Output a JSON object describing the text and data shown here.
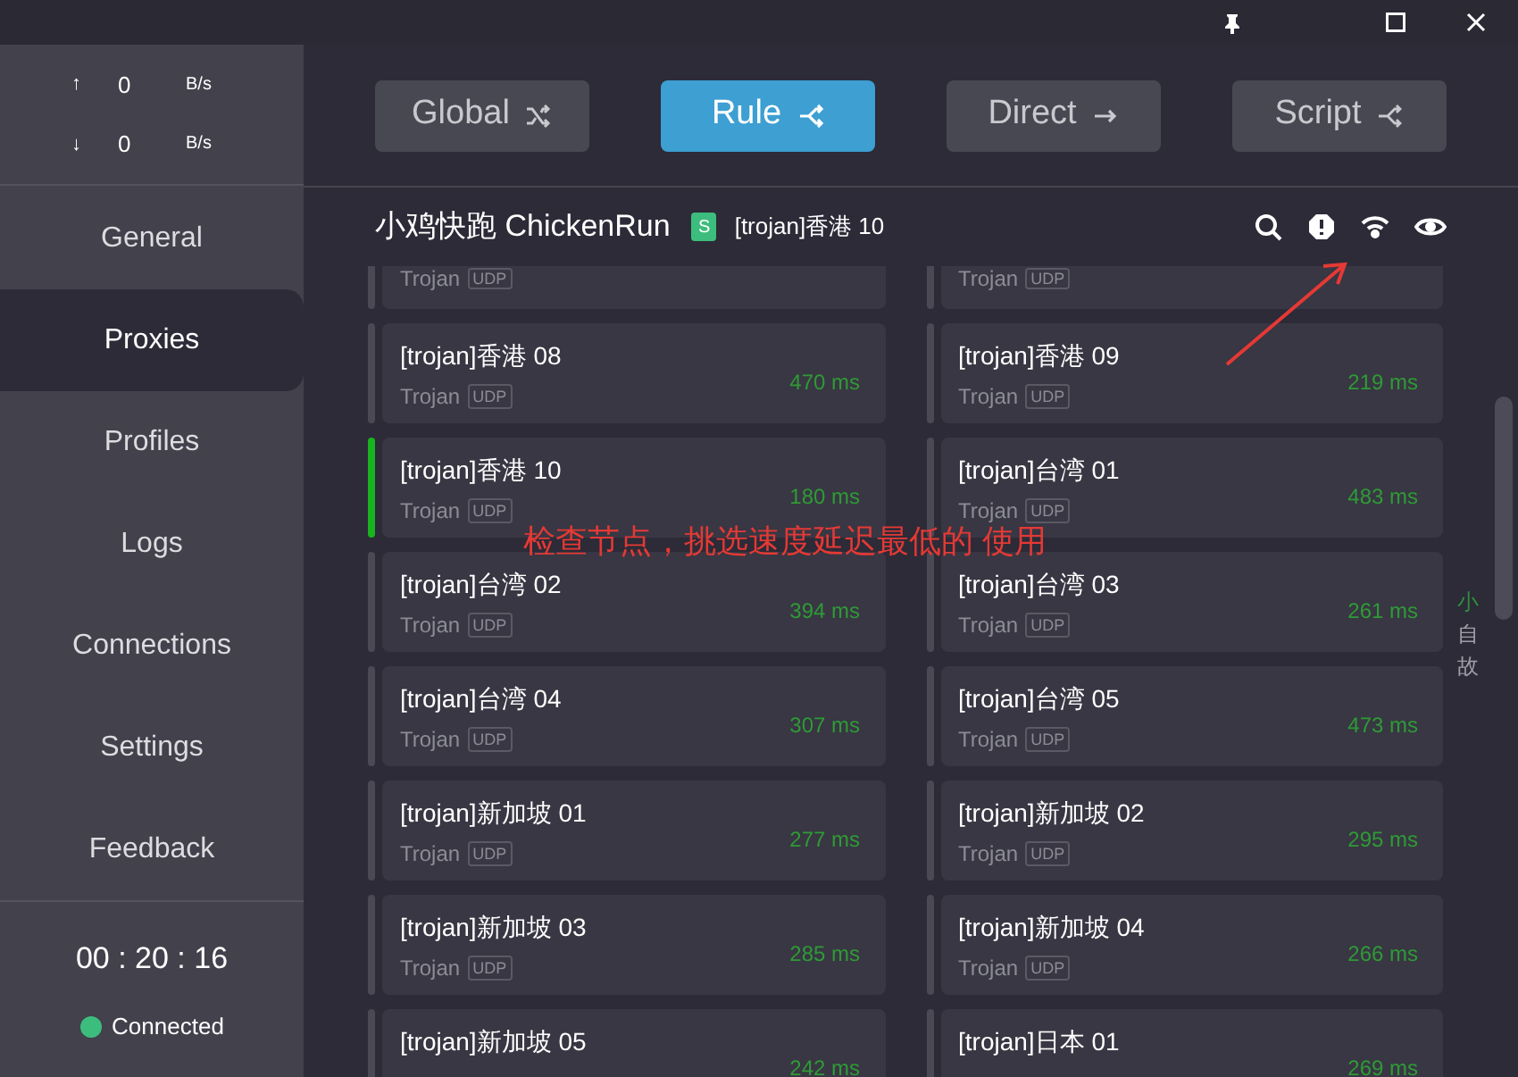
{
  "traffic": [
    {
      "arrow": "↑",
      "value": "0",
      "unit": "B/s"
    },
    {
      "arrow": "↓",
      "value": "0",
      "unit": "B/s"
    }
  ],
  "nav": [
    {
      "label": "General",
      "selected": false
    },
    {
      "label": "Proxies",
      "selected": true
    },
    {
      "label": "Profiles",
      "selected": false
    },
    {
      "label": "Logs",
      "selected": false
    },
    {
      "label": "Connections",
      "selected": false
    },
    {
      "label": "Settings",
      "selected": false
    },
    {
      "label": "Feedback",
      "selected": false
    }
  ],
  "timer": "00 : 20 : 16",
  "status": {
    "label": "Connected",
    "color": "#3dbd7d"
  },
  "modes": [
    {
      "label": "Global",
      "kind": "global",
      "selected": false
    },
    {
      "label": "Rule",
      "kind": "rule",
      "selected": true
    },
    {
      "label": "Direct",
      "kind": "direct",
      "selected": false
    },
    {
      "label": "Script",
      "kind": "script",
      "selected": false
    }
  ],
  "group": {
    "name": "小鸡快跑 ChickenRun",
    "badge": "S",
    "current": "[trojan]香港 10"
  },
  "partial_row": [
    {
      "type": "Trojan",
      "udp": "UDP"
    },
    {
      "type": "Trojan",
      "udp": "UDP"
    }
  ],
  "proxies": [
    {
      "name": "[trojan]香港 08",
      "type": "Trojan",
      "udp": "UDP",
      "delay": "470 ms",
      "selected": false
    },
    {
      "name": "[trojan]香港 09",
      "type": "Trojan",
      "udp": "UDP",
      "delay": "219 ms",
      "selected": false
    },
    {
      "name": "[trojan]香港 10",
      "type": "Trojan",
      "udp": "UDP",
      "delay": "180 ms",
      "selected": true
    },
    {
      "name": "[trojan]台湾 01",
      "type": "Trojan",
      "udp": "UDP",
      "delay": "483 ms",
      "selected": false
    },
    {
      "name": "[trojan]台湾 02",
      "type": "Trojan",
      "udp": "UDP",
      "delay": "394 ms",
      "selected": false
    },
    {
      "name": "[trojan]台湾 03",
      "type": "Trojan",
      "udp": "UDP",
      "delay": "261 ms",
      "selected": false
    },
    {
      "name": "[trojan]台湾 04",
      "type": "Trojan",
      "udp": "UDP",
      "delay": "307 ms",
      "selected": false
    },
    {
      "name": "[trojan]台湾 05",
      "type": "Trojan",
      "udp": "UDP",
      "delay": "473 ms",
      "selected": false
    },
    {
      "name": "[trojan]新加坡 01",
      "type": "Trojan",
      "udp": "UDP",
      "delay": "277 ms",
      "selected": false
    },
    {
      "name": "[trojan]新加坡 02",
      "type": "Trojan",
      "udp": "UDP",
      "delay": "295 ms",
      "selected": false
    },
    {
      "name": "[trojan]新加坡 03",
      "type": "Trojan",
      "udp": "UDP",
      "delay": "285 ms",
      "selected": false
    },
    {
      "name": "[trojan]新加坡 04",
      "type": "Trojan",
      "udp": "UDP",
      "delay": "266 ms",
      "selected": false
    },
    {
      "name": "[trojan]新加坡 05",
      "delay": "242 ms",
      "selected": false
    },
    {
      "name": "[trojan]日本 01",
      "delay": "269 ms",
      "selected": false
    }
  ],
  "side_chars": [
    {
      "text": "小",
      "color": "#2f8f3c"
    },
    {
      "text": "自",
      "color": "#a0a0aa"
    },
    {
      "text": "故",
      "color": "#a0a0aa"
    }
  ],
  "annotation": "检查节点，挑选速度延迟最低的 使用"
}
